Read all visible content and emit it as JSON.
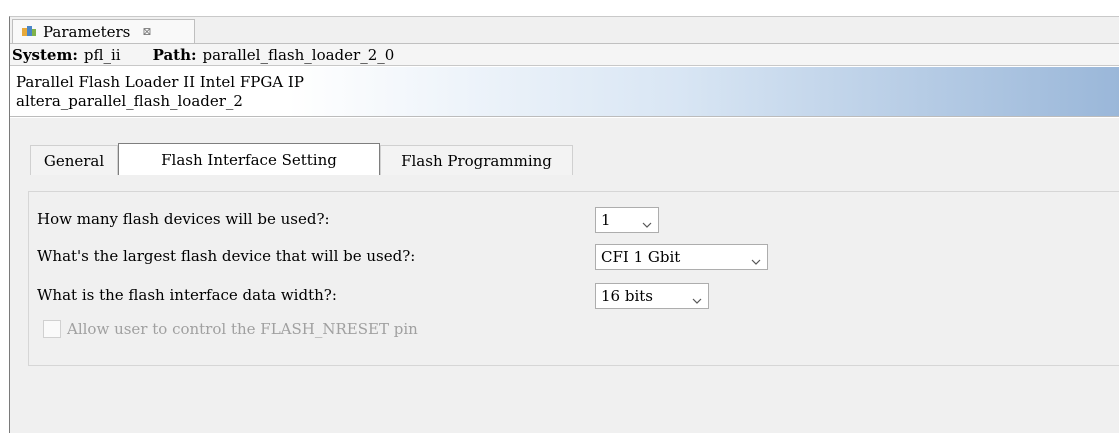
{
  "view": {
    "title": "Parameters",
    "close_glyph": "⊠",
    "icon": "parameters-icon"
  },
  "system_bar": {
    "system_label": "System:",
    "system_value": "pfl_ii",
    "path_label": "Path:",
    "path_value": "parallel_flash_loader_2_0"
  },
  "header": {
    "name": "Parallel Flash Loader II Intel FPGA IP",
    "id": "altera_parallel_flash_loader_2"
  },
  "tabs": [
    {
      "label": "General"
    },
    {
      "label": "Flash Interface Setting"
    },
    {
      "label": "Flash Programming"
    }
  ],
  "settings": {
    "devices_label": "How many flash devices will be used?:",
    "devices_value": "1",
    "largest_label": "What's the largest flash device that will be used?:",
    "largest_value": "CFI 1 Gbit",
    "width_label": "What is the flash interface data width?:",
    "width_value": "16 bits",
    "reset_label": "Allow user to control the FLASH_NRESET pin",
    "reset_checked": false
  },
  "colors": {
    "header_gradient_end": "#9ab7d9",
    "panel_bg": "#f0f0f0"
  }
}
